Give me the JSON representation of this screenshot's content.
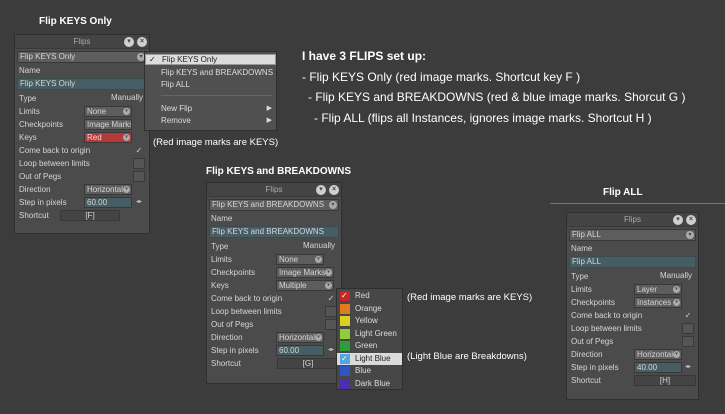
{
  "captions": {
    "p1": "Flip KEYS Only",
    "p2": "Flip KEYS and BREAKDOWNS",
    "p3": "Flip ALL"
  },
  "notes": {
    "red_marks": "(Red image marks are KEYS)",
    "red_marks2": "(Red image marks are KEYS)",
    "light_blue": "(Light Blue are Breakdowns)"
  },
  "setup_text": {
    "title": "I have 3 FLIPS set up:",
    "line1": "- Flip KEYS Only  (red image marks. Shortcut key F )",
    "line2": "- Flip KEYS and BREAKDOWNS (red & blue image marks. Shorcut G )",
    "line3": "- Flip ALL  (flips all Instances, ignores image marks. Shortcut H )"
  },
  "labels": {
    "panel_title": "Flips",
    "name": "Name",
    "type": "Type",
    "limits": "Limits",
    "checkpoints": "Checkpoints",
    "keys": "Keys",
    "come_back": "Come back to origin",
    "loop": "Loop between limits",
    "out_of_pegs": "Out of Pegs",
    "direction": "Direction",
    "step": "Step in pixels",
    "shortcut": "Shortcut"
  },
  "panel1": {
    "selector": "Flip KEYS Only",
    "name_value": "Flip KEYS Only",
    "type_value": "Manually",
    "limits_value": "None",
    "checkpoints_value": "Image Marks",
    "keys_value": "Red",
    "come_back_checked": "✓",
    "direction_value": "Horizontal",
    "step_value": "60.00",
    "shortcut_value": "[F]"
  },
  "panel2": {
    "selector": "Flip KEYS and BREAKDOWNS",
    "name_value": "Flip KEYS and BREAKDOWNS",
    "type_value": "Manually",
    "limits_value": "None",
    "checkpoints_value": "Image Marks",
    "keys_value": "Multiple",
    "come_back_checked": "✓",
    "direction_value": "Horizontal",
    "step_value": "60.00",
    "shortcut_value": "[G]"
  },
  "panel3": {
    "selector": "Flip ALL",
    "name_value": "Flip ALL",
    "type_value": "Manually",
    "limits_value": "Layer",
    "checkpoints_value": "Instances",
    "come_back_checked": "✓",
    "direction_value": "Horizontal",
    "step_value": "40.00",
    "shortcut_value": "[H]"
  },
  "flip_menu": {
    "items": [
      "Flip KEYS Only",
      "Flip KEYS and BREAKDOWNS",
      "Flip ALL",
      "New Flip",
      "Remove"
    ],
    "selected_index": 0,
    "check": "✓",
    "submenu_arrow": "▶"
  },
  "color_list": {
    "items": [
      {
        "label": "Red",
        "color": "#c62828",
        "checked": true
      },
      {
        "label": "Orange",
        "color": "#e07b20",
        "checked": false
      },
      {
        "label": "Yellow",
        "color": "#d9d21f",
        "checked": false
      },
      {
        "label": "Light Green",
        "color": "#8fce3a",
        "checked": false
      },
      {
        "label": "Green",
        "color": "#2e9e3a",
        "checked": false
      },
      {
        "label": "Light Blue",
        "color": "#55a6e0",
        "checked": true
      },
      {
        "label": "Blue",
        "color": "#2e55c8",
        "checked": false
      },
      {
        "label": "Dark Blue",
        "color": "#4b2cb5",
        "checked": false
      }
    ],
    "selected_index": 5,
    "check": "✓"
  },
  "icons": {
    "chevron": "chevron-down-icon",
    "close": "close-icon",
    "spin": "spin-arrows-icon"
  }
}
